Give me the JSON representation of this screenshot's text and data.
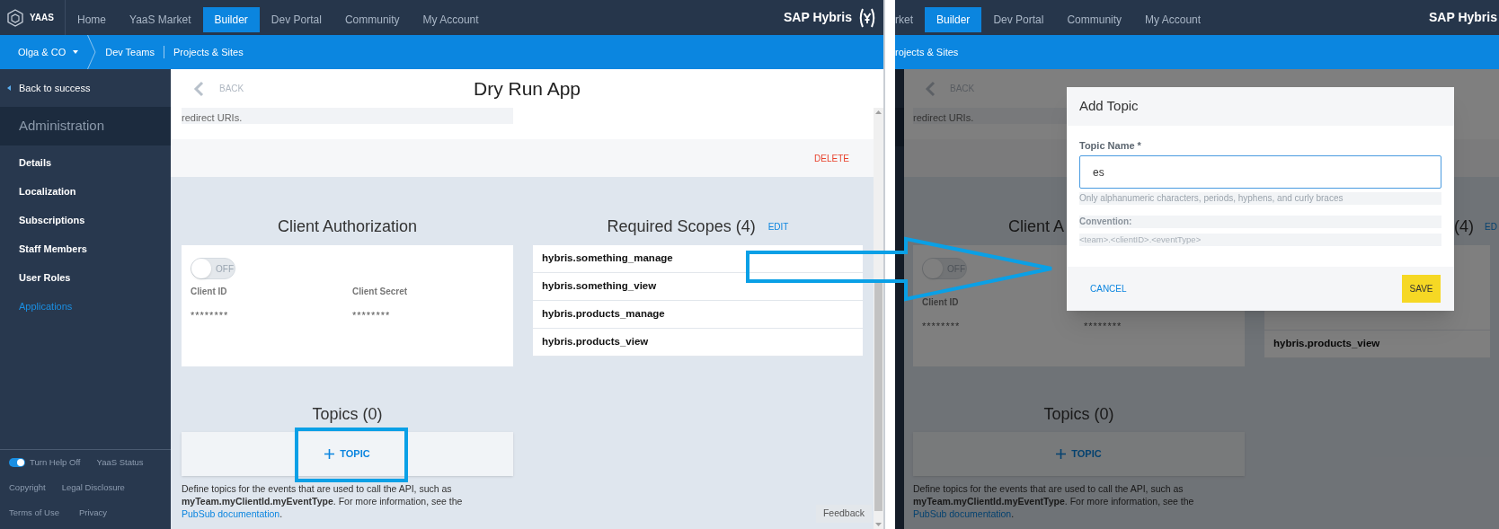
{
  "left_screen": {
    "top_nav": {
      "logo_text": "YAAS",
      "items": [
        {
          "label": "Home",
          "selected": false
        },
        {
          "label": "YaaS Market",
          "selected": false
        },
        {
          "label": "Builder",
          "selected": true
        },
        {
          "label": "Dev Portal",
          "selected": false
        },
        {
          "label": "Community",
          "selected": false
        },
        {
          "label": "My Account",
          "selected": false
        }
      ],
      "brand": "SAP Hybris"
    },
    "breadcrumb": {
      "org": "Olga & CO",
      "items": [
        "Dev Teams",
        "Projects & Sites"
      ]
    },
    "sidebar": {
      "back_link": "Back to success",
      "section_title": "Administration",
      "items": [
        {
          "label": "Details",
          "selected": false
        },
        {
          "label": "Localization",
          "selected": false
        },
        {
          "label": "Subscriptions",
          "selected": false
        },
        {
          "label": "Staff Members",
          "selected": false
        },
        {
          "label": "User Roles",
          "selected": false
        },
        {
          "label": "Applications",
          "selected": true
        }
      ],
      "help_toggle": {
        "label": "Turn Help Off",
        "on": true
      },
      "footer_links": [
        "YaaS Status",
        "Copyright",
        "Legal Disclosure",
        "Terms of Use",
        "Privacy"
      ]
    },
    "header": {
      "back": "BACK",
      "title": "Dry Run App"
    },
    "redirect_text": "redirect URIs.",
    "delete": "DELETE",
    "client_authorization": {
      "title": "Client Authorization",
      "toggle": {
        "label": "OFF",
        "on": false
      },
      "fields": [
        {
          "label": "Client ID",
          "value": "********"
        },
        {
          "label": "Client Secret",
          "value": "********"
        }
      ]
    },
    "required_scopes": {
      "title": "Required Scopes (4)",
      "edit": "EDIT",
      "items": [
        "hybris.something_manage",
        "hybris.something_view",
        "hybris.products_manage",
        "hybris.products_view"
      ]
    },
    "topics": {
      "title": "Topics (0)",
      "add_button": "TOPIC",
      "description": "Define topics for the events that are used to call the API, such as **myTeam.myClientId.myEventType**. For more information, see the",
      "link": "PubSub documentation",
      "description_end": "."
    },
    "feedback": "Feedback"
  },
  "right_screen": {
    "top_nav": {
      "items": [
        {
          "label": "rket",
          "selected": false
        },
        {
          "label": "Builder",
          "selected": true
        },
        {
          "label": "Dev Portal",
          "selected": false
        },
        {
          "label": "Community",
          "selected": false
        },
        {
          "label": "My Account",
          "selected": false
        }
      ],
      "brand": "SAP Hybris"
    },
    "breadcrumb": {
      "items": [
        "rojects & Sites"
      ]
    },
    "header": {
      "back": "BACK"
    },
    "redirect_text": "redirect URIs.",
    "client_authorization": {
      "title": "Client A",
      "toggle": {
        "label": "OFF",
        "on": false
      },
      "fields": [
        {
          "label": "Client ID",
          "value": "********"
        },
        {
          "value": "********"
        }
      ]
    },
    "required_scopes": {
      "title": "(4)",
      "edit": "ED",
      "items": [
        "hybris.products_view"
      ]
    },
    "topics": {
      "title": "Topics (0)",
      "add_button": "TOPIC",
      "description": "Define topics for the events that are used to call the API, such as **myTeam.myClientId.myEventType**. For more information, see the",
      "link": "PubSub documentation",
      "description_end": "."
    },
    "dialog": {
      "title": "Add Topic",
      "field_label": "Topic Name *",
      "value": "es",
      "hint": "Only alphanumeric characters, periods, hyphens, and curly braces",
      "convention_label": "Convention:",
      "convention": "<team>.<clientID>.<eventType>",
      "cancel": "CANCEL",
      "save": "SAVE"
    }
  }
}
